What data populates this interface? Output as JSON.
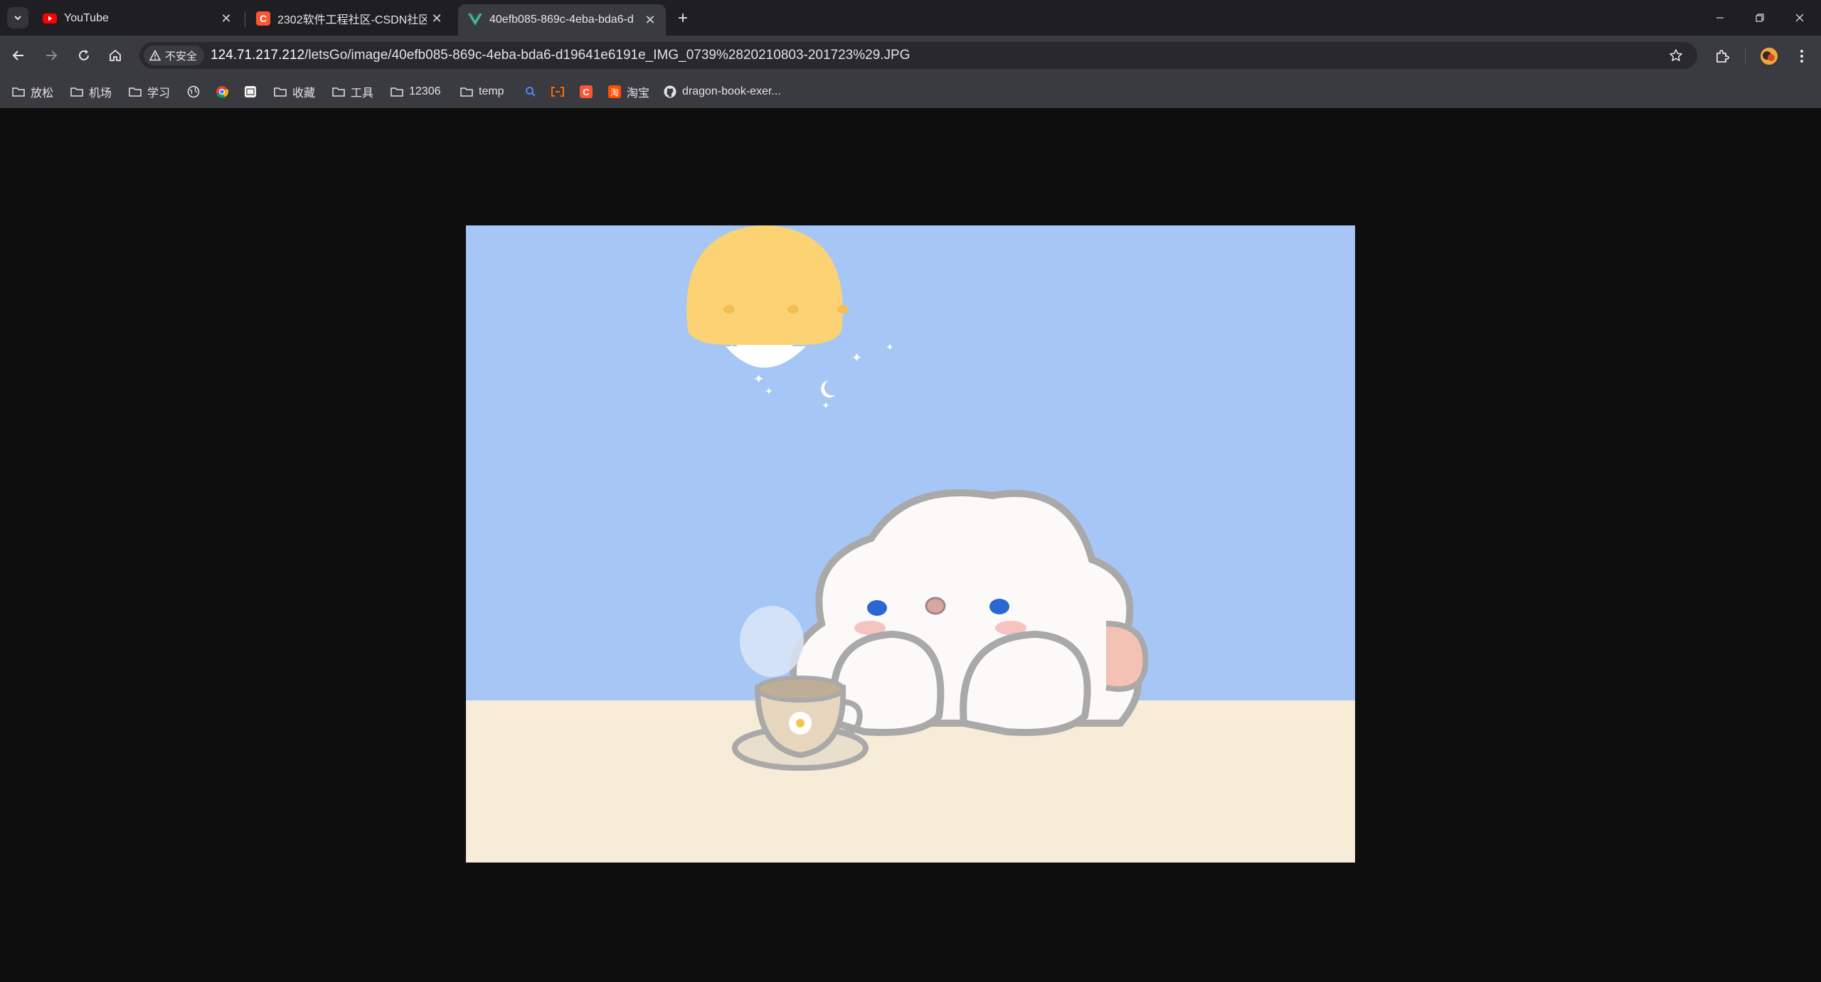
{
  "tabs": [
    {
      "title": "YouTube",
      "active": false,
      "icon": "youtube-icon"
    },
    {
      "title": "2302软件工程社区-CSDN社区",
      "active": false,
      "icon": "csdn-icon"
    },
    {
      "title": "40efb085-869c-4eba-bda6-d",
      "active": true,
      "icon": "vue-icon"
    }
  ],
  "address_bar": {
    "security_label": "不安全",
    "host": "124.71.217.212",
    "path": "/letsGo/image/40efb085-869c-4eba-bda6-d19641e6191e_IMG_0739%2820210803-201723%29.JPG"
  },
  "bookmarks": [
    {
      "label": "放松",
      "icon": "folder-icon"
    },
    {
      "label": "机场",
      "icon": "folder-icon"
    },
    {
      "label": "学习",
      "icon": "folder-icon"
    },
    {
      "label": "",
      "icon": "globe-icon"
    },
    {
      "label": "",
      "icon": "chrome-icon"
    },
    {
      "label": "",
      "icon": "bookmark-app-icon"
    },
    {
      "label": "收藏",
      "icon": "folder-icon"
    },
    {
      "label": "工具",
      "icon": "folder-icon"
    },
    {
      "label": "12306",
      "icon": "folder-icon"
    },
    {
      "label": "temp",
      "icon": "folder-icon"
    },
    {
      "label": "",
      "icon": "search-icon"
    },
    {
      "label": "",
      "icon": "bracket-icon"
    },
    {
      "label": "",
      "icon": "csdn-icon"
    },
    {
      "label": "淘宝",
      "icon": "taobao-icon"
    },
    {
      "label": "dragon-book-exer...",
      "icon": "github-icon"
    }
  ],
  "colors": {
    "tabstrip": "#1f1f23",
    "toolbar": "#3a3a41",
    "viewer_bg": "#0e0e0e",
    "sky": "#a6c6f5",
    "table": "#f7ecd7",
    "lamp": "#fcd374"
  }
}
